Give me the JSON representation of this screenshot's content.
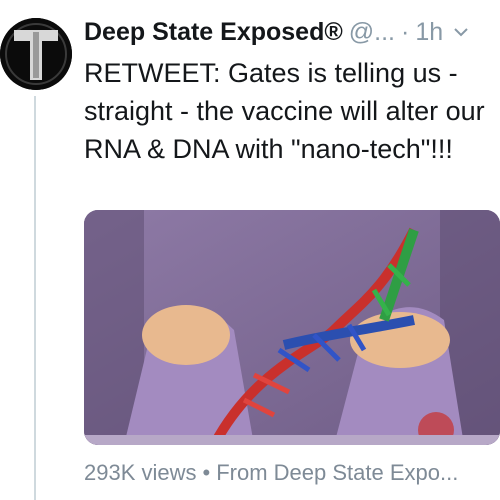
{
  "tweet": {
    "author": "Deep State Exposed®",
    "handle": "@...",
    "separator": "·",
    "time": "1h",
    "text": "RETWEET: Gates is telling us - straight - the vaccine will alter our RNA & DNA with \"nano-tech\"!!!",
    "avatar_icon": "avatar-logo-icon",
    "menu_icon": "chevron-down-icon"
  },
  "media": {
    "type": "video-thumbnail",
    "description_icon": "video-frame"
  },
  "footer": {
    "views": "293K views",
    "dot": "•",
    "source": "From Deep State Expo..."
  },
  "colors": {
    "text_primary": "#14171a",
    "text_secondary": "#8899a6",
    "footer": "#7e8a96",
    "thread_line": "#cfd9de"
  }
}
